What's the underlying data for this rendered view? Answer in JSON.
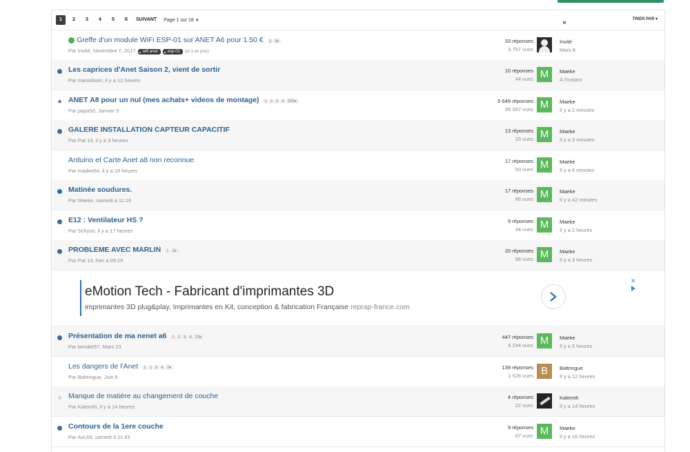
{
  "pagination": {
    "pages": [
      "1",
      "2",
      "3",
      "4",
      "5",
      "6"
    ],
    "next": "SUIVANT",
    "last": "»",
    "page_of": "Page 1 sur 18",
    "sort": "TRIER PAR"
  },
  "topics": [
    {
      "title": "Greffe d'un module WiFi ESP-01 sur ANET A6 pour 1.50 €",
      "bold": false,
      "mark": "lock",
      "pages": [
        "1",
        "2"
      ],
      "meta": "Par Invité, Novembre 7, 2017",
      "tags": [
        "wifi anet",
        "esp-01"
      ],
      "more": "(et 1 en plus)",
      "replies": "33 réponses",
      "views": "3 757 vues",
      "avatar": "guest",
      "avatar_letter": "",
      "last_user": "Invité",
      "last_time": "Mars 8",
      "alt": false
    },
    {
      "title": "Les caprices d'Anet Saison 2, vient de sortir",
      "bold": true,
      "mark": "dot",
      "pages": [],
      "meta": "Par mariolitwin, il y a 12 heures",
      "replies": "10 réponses",
      "views": "44 vues",
      "avatar": "green",
      "avatar_letter": "M",
      "last_user": "Maeke",
      "last_time": "À l'instant",
      "alt": true
    },
    {
      "title": "ANET A8 pour un nul (mes achats+ videos de montage)",
      "bold": true,
      "mark": "star",
      "pages": [
        "1",
        "2",
        "3",
        "4",
        "283"
      ],
      "meta": "Par papa50, Janvier 5",
      "replies": "5 649 réponses",
      "views": "85 567 vues",
      "avatar": "green",
      "avatar_letter": "M",
      "last_user": "Maeke",
      "last_time": "Il y a 2 minutes",
      "alt": false
    },
    {
      "title": "GALERE INSTALLATION CAPTEUR CAPACITIF",
      "bold": true,
      "mark": "dot",
      "pages": [],
      "meta": "Par Pat 13, il y a 3 heures",
      "replies": "13 réponses",
      "views": "33 vues",
      "avatar": "green",
      "avatar_letter": "M",
      "last_user": "Maeke",
      "last_time": "Il y a 3 minutes",
      "alt": true
    },
    {
      "title": "Arduino et Carte Anet a8 non reconnue",
      "bold": false,
      "mark": "",
      "pages": [],
      "meta": "Par madeo54, il y a 18 heures",
      "replies": "17 réponses",
      "views": "50 vues",
      "avatar": "green",
      "avatar_letter": "M",
      "last_user": "Maeke",
      "last_time": "Il y a 4 minutes",
      "alt": false
    },
    {
      "title": "Matinée soudures.",
      "bold": true,
      "mark": "dot",
      "pages": [],
      "meta": "Par Maeke, samedi à 11:16",
      "replies": "17 réponses",
      "views": "86 vues",
      "avatar": "green",
      "avatar_letter": "M",
      "last_user": "Maeke",
      "last_time": "Il y a 42 minutes",
      "alt": true
    },
    {
      "title": "E12 : Ventilateur HS ?",
      "bold": true,
      "mark": "dot",
      "pages": [],
      "meta": "Par Schyzo, il y a 17 heures",
      "replies": "9 réponses",
      "views": "34 vues",
      "avatar": "green",
      "avatar_letter": "M",
      "last_user": "Maeke",
      "last_time": "Il y a 2 heures",
      "alt": false
    },
    {
      "title": "PROBLEME AVEC MARLIN",
      "bold": true,
      "mark": "dot",
      "pages": [
        "1",
        "2"
      ],
      "meta": "Par Pat 13, hier à 09:19",
      "replies": "20 réponses",
      "views": "96 vues",
      "avatar": "green",
      "avatar_letter": "M",
      "last_user": "Maeke",
      "last_time": "Il y a 3 heures",
      "alt": true
    },
    {
      "title": "Présentation de ma nenet a6",
      "bold": true,
      "mark": "dot",
      "pages": [
        "1",
        "2",
        "3",
        "4",
        "23"
      ],
      "meta": "Par bender57, Mars 23",
      "replies": "447 réponses",
      "views": "6 244 vues",
      "avatar": "green",
      "avatar_letter": "M",
      "last_user": "Maeke",
      "last_time": "Il y a 5 heures",
      "alt": true
    },
    {
      "title": "Les dangers de l'Anet",
      "bold": false,
      "mark": "",
      "pages": [
        "1",
        "2",
        "3",
        "4",
        "7"
      ],
      "meta": "Par Baltringue, Juin 6",
      "replies": "139 réponses",
      "views": "1 528 vues",
      "avatar": "tan",
      "avatar_letter": "B",
      "last_user": "Baltringue",
      "last_time": "Il y a 12 heures",
      "alt": false
    },
    {
      "title": "Manque de matière au changement de couche",
      "bold": false,
      "mark": "star-light",
      "pages": [],
      "meta": "Par Kalemth, il y a 14 heures",
      "replies": "4 réponses",
      "views": "22 vues",
      "avatar": "photo",
      "avatar_letter": "",
      "last_user": "Kalemth",
      "last_time": "Il y a 14 heures",
      "alt": true
    },
    {
      "title": "Contours de la 1ere couche",
      "bold": true,
      "mark": "dot",
      "pages": [],
      "meta": "Par AxL69, samedi à 11:43",
      "replies": "9 réponses",
      "views": "67 vues",
      "avatar": "green",
      "avatar_letter": "M",
      "last_user": "Maeke",
      "last_time": "Il y a 16 heures",
      "alt": false
    }
  ],
  "ad": {
    "headline": "eMotion Tech - Fabricant d'imprimantes 3D",
    "description": "imprimantes 3D plug&play, Imprimantes en Kit, conception & fabrication Française",
    "domain": "reprap-france.com",
    "close": "✕"
  }
}
